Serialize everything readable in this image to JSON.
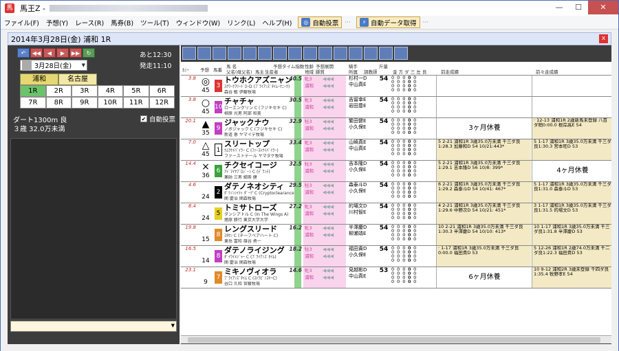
{
  "window": {
    "title": "馬王Z -",
    "minimize": "—",
    "maximize": "☐",
    "close": "✕"
  },
  "menu": {
    "items": [
      "ファイル(F)",
      "予想(Y)",
      "レース(R)",
      "馬券(B)",
      "ツール(T)",
      "ウィンドウ(W)",
      "リンク(L)",
      "ヘルプ(H)"
    ],
    "auto_bet_label": "自動投票",
    "auto_data_label": "自動データ取得",
    "dots": "···"
  },
  "race_header": {
    "title": "2014年3月28日(金) 浦和 1R",
    "close": "x"
  },
  "left": {
    "ato": "あと12:30",
    "hasso": "発走11:10",
    "date": "3月28日(金)",
    "venues": [
      "浦和",
      "名古屋"
    ],
    "races": [
      "1R",
      "2R",
      "3R",
      "4R",
      "5R",
      "6R",
      "7R",
      "8R",
      "9R",
      "10R",
      "11R",
      "12R"
    ],
    "cond1": "ダート1300m 良",
    "cond2": "３歳 32.0万未満",
    "auto_bet": "自動投票",
    "check": "✔"
  },
  "grid_header": {
    "col1": "ｶﾐｰ",
    "col2": "予想",
    "col3": "馬番",
    "col4a": "馬 名",
    "col4b": "父名(母父名)",
    "col4c": "馬主",
    "col4d": "生産者",
    "col5": "予想タイム指数",
    "col6a": "性齢",
    "col6b": "地域",
    "col6c": "予想展開",
    "col6d": "脚質",
    "col7a": "騎手",
    "col7b": "所属",
    "col8": "斤量",
    "col9": "調教師",
    "col10": "金 方 ダ 三 左 良",
    "prev1": "前走成績",
    "prev2": "前々走成績"
  },
  "horses": [
    {
      "rank": "3.8",
      "mark": "◎",
      "pop": "45",
      "num": "3",
      "color": "#d33",
      "name": "トウホクアズニャン",
      "sire": "ｽｸﾜｰｸﾌﾘｰﾄﾞﾛｰD (ﾌﾞﾗｲｱﾝｽﾞﾀｲﾑｰｸﾆｰｸ)",
      "owner": "森谷 敏",
      "breeder": "伊藤牧場",
      "idx": "40.5",
      "sex": "牝3",
      "area": "浦和",
      "jockey": "杉村一D",
      "jockey2": "中山真E",
      "wt": "54",
      "prev": "",
      "prev2": ""
    },
    {
      "rank": "3.8",
      "mark": "○",
      "pop": "45",
      "num": "10",
      "color": "#c23ec2",
      "name": "チャチャ",
      "sire": "ローエングリン C (フジキセキ C)",
      "owner": "柳原 光男",
      "breeder": "阿部 和美",
      "idx": "30.5",
      "sex": "牝3",
      "area": "浦和",
      "jockey": "吉留幸E",
      "jockey2": "岩田豊E",
      "wt": "54",
      "prev": "",
      "prev2": ""
    },
    {
      "rank": "20.1",
      "mark": "▲",
      "pop": "35",
      "num": "9",
      "color": "#c23ec2",
      "name": "ジャックナウ",
      "sire": "ノボジャック C (フジキセキ C)",
      "owner": "新道 恵",
      "breeder": "ヤマイデ牧場",
      "idx": "32.9",
      "sex": "牡3",
      "area": "浦和",
      "jockey": "繁田健E",
      "jockey2": "小久保E",
      "wt": "54",
      "prev": "3ヶ月休養",
      "prev2": "· 12-13 浦和1R 2歳新馬未登録 八百ダ稍0:00.0 根岸高E 54"
    },
    {
      "rank": "7.0",
      "mark": "△",
      "pop": "45",
      "num": "1",
      "color": "#ffffff",
      "name": "スリートップ",
      "sire": "ﾅﾑﾗｹｲﾊﾟｲﾗｰ C (ﾌｧｰｽﾄｹｲﾊﾟｲﾗｰ)",
      "owner": "ファーストテール",
      "breeder": "ヤマタケ牧場",
      "idx": "33.4",
      "sex": "牝3",
      "area": "浦和",
      "jockey": "山崎真E",
      "jockey2": "中山真E",
      "wt": "54",
      "prev": "5 2-21 浦和1R 3歳35.0万未満 千三ダ良1:28.3 加藤和D 54 10/21:443*",
      "prev2": "5 1-17 浦和1R 3歳35.0万未満 千三ダ良1:30.3 宮本旺D 53"
    },
    {
      "rank": "14.4",
      "mark": "×",
      "pop": "36",
      "num": "6",
      "color": "#3aa23a",
      "name": "チクセイコージ",
      "sire": "ｱﾄﾞﾏｲﾔﾌﾟﾛｼﾞｰﾝ C (ﾃﾞﾗﾝﾃ)",
      "owner": "薬師 三男",
      "breeder": "細茶 健",
      "idx": "32.5",
      "sex": "牡3",
      "area": "浦和",
      "jockey": "吉本隆D",
      "jockey2": "小久保E",
      "wt": "54",
      "prev": "5 2-21 浦和1R 3歳35.0万未満 千三ダ良1:29.1 吉本隆D 56 10/8: 399*",
      "prev2": "4ヶ月休養"
    },
    {
      "rank": "4.6",
      "mark": "",
      "pop": "24",
      "num": "2",
      "color": "#000",
      "name": "ダテノネオシティ",
      "sire": "ﾀﾞﾂﾉﾝｼｲﾃｨ ﾀﾞｰﾂﾞC (Cryptoclearance)",
      "owner": "関 慶治",
      "breeder": "関森牧場",
      "idx": "29.5",
      "sex": "牡3",
      "area": "浦和",
      "jockey": "森泰斗D",
      "jockey2": "小久保E",
      "wt": "54",
      "prev": "6 2-21 浦和1R 3歳35.0万未満 千三ダ良1:29.2 森泰斗D 54 10/41: 467*",
      "prev2": "5 1-17 浦和1R 3歳35.0万未満 千三ダ良1:31.0 森泰斗D 53"
    },
    {
      "rank": "8.4",
      "mark": "",
      "pop": "24",
      "num": "5",
      "color": "#e5d021",
      "name": "トミサトローズ",
      "sire": "ダンシアトル C (In The Wings A)",
      "owner": "猪原 勝行",
      "breeder": "東京大学大学",
      "idx": "27.2",
      "sex": "牝3",
      "area": "浦和",
      "jockey": "的場文D",
      "jockey2": "川村智E",
      "wt": "54",
      "prev": "4 2-21 浦和1R 3歳35.0万未満 千三ダ良1:29.6 中野次D 54 10/21: 451*",
      "prev2": "3 1-17 浦和1R 3歳35.0万未満 千三ダ良1:31.5 的場文D 53"
    },
    {
      "rank": "19.8",
      "mark": "",
      "pop": "15",
      "num": "8",
      "color": "#e08a2a",
      "name": "レングスリード",
      "sire": "ｽﾀｾﾝ C (チーフベアハート C)",
      "owner": "東岳 富和",
      "breeder": "雄谷 勇一",
      "idx": "16.2",
      "sex": "牝3",
      "area": "浦和",
      "jockey": "半澤慶D",
      "jockey2": "柳瀬靖E",
      "wt": "54",
      "prev": "10 2-21 浦和1R 3歳35.0万未満 千三ダ良1:30.3 半澤慶D 54 10/10: 413*",
      "prev2": "10 1-17 浦和1R 3歳35.0万未満 千三ダ良1:31.8 半澤慶D 53"
    },
    {
      "rank": "16.5",
      "mark": "",
      "pop": "14",
      "num": "8",
      "color": "#c23ec2",
      "name": "ダテノライジング",
      "sire": "ﾀﾞｲﾜｲﾒｼﾞｬｰ C (ﾌﾞﾗｲｱﾝｽﾞﾀｲﾑ)",
      "owner": "関 慶治",
      "breeder": "関森牧場",
      "idx": "18.2",
      "sex": "牡3",
      "area": "浦和",
      "jockey": "福田貴D",
      "jockey2": "小久保E",
      "wt": "54",
      "prev": "· 1-17 浦和1R 3歳35.0万未満 千三ダ良0:00.0 福田貴D 53",
      "prev2": "5 12-26 浦和1R 2歳74.0万未満 千二ダ良1:22.3 福田貴D 53"
    },
    {
      "rank": "23.1",
      "mark": "",
      "pop": "9",
      "num": "7",
      "color": "#e08a2a",
      "name": "ミキノヴィオラ",
      "sire": "ﾌﾞﾗｲｱﾝｽﾞﾀｲﾑ C (ｽﾄﾗﾋﾞﾝｽｷｰC)",
      "owner": "谷口 久和",
      "breeder": "宮藤牧場",
      "idx": "14.6",
      "sex": "牝3",
      "area": "浦和",
      "jockey": "見越彬D",
      "jockey2": "中山真E",
      "wt": "53",
      "prev": "6ヶ月休養",
      "prev2": "10 9-12 浦和2R 3歳未登録 千四ダ良1:35.4 牧野孝E 54"
    }
  ]
}
